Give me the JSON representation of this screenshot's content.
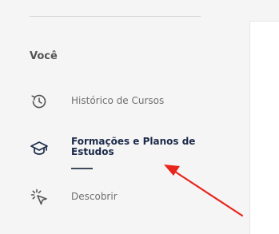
{
  "sidebar": {
    "section_title": "Você",
    "items": [
      {
        "label": "Histórico de Cursos",
        "icon": "history-icon",
        "active": false
      },
      {
        "label_lines": [
          "Formações e Planos de",
          "Estudos"
        ],
        "icon": "graduation-cap-icon",
        "active": true
      },
      {
        "label": "Descobrir",
        "icon": "sparkle-cursor-icon",
        "active": false
      }
    ]
  },
  "annotation": {
    "arrow_color": "#e8261c"
  },
  "colors": {
    "active_text": "#1c2a4a",
    "inactive_text": "#707070",
    "section_title": "#545454",
    "background": "#f5f5f5"
  }
}
